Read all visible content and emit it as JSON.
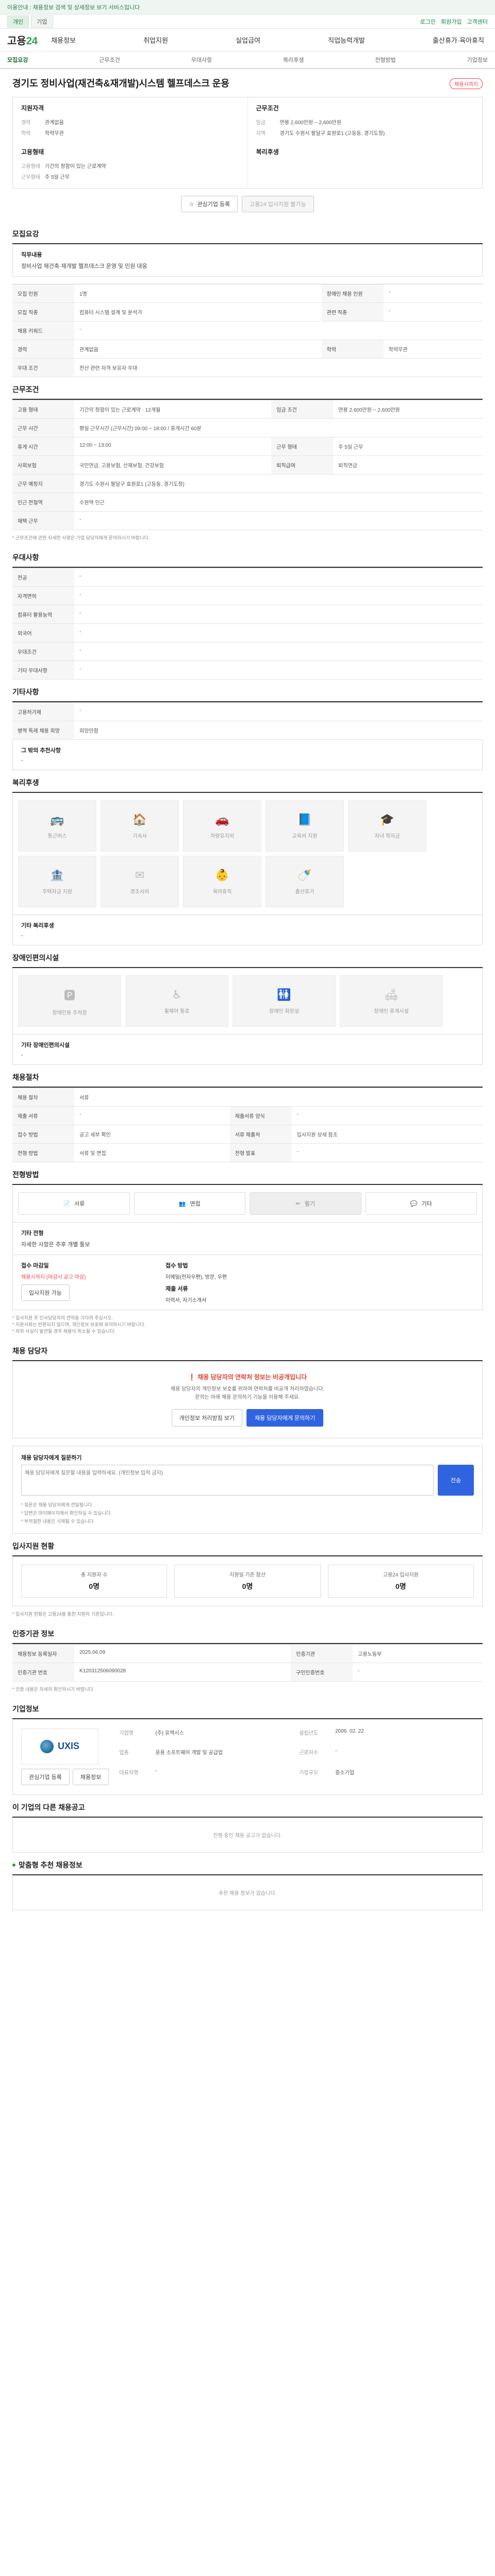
{
  "topbar": {
    "notice": "이용안내 : 채용정보 검색 및 상세정보 보기 서비스입니다"
  },
  "header": {
    "tabs": [
      "개인",
      "기업"
    ],
    "links": [
      "로그인",
      "회원가입",
      "고객센터"
    ]
  },
  "logo": {
    "main": "고용",
    "accent": "24"
  },
  "gnb": [
    "채용정보",
    "취업지원",
    "실업급여",
    "직업능력개발",
    "출산휴가·육아휴직"
  ],
  "subnav": [
    "모집요강",
    "근무조건",
    "우대사항",
    "복리후생",
    "전형방법",
    "기업정보"
  ],
  "job": {
    "title": "경기도 정비사업(재건축&재개발)시스템 헬프데스크 운용",
    "badge": "채용시까지"
  },
  "summary": {
    "left": {
      "title": "지원자격",
      "rows": [
        {
          "k": "경력",
          "v": "관계없음"
        },
        {
          "k": "학력",
          "v": "학력무관"
        }
      ]
    },
    "right": {
      "title": "근무조건",
      "rows": [
        {
          "k": "임금",
          "v": "연봉 2,600만원 ~ 2,600만원"
        },
        {
          "k": "지역",
          "v": "경기도 수원시 팔달구 효원로1 (고등동, 경기도청)"
        }
      ]
    },
    "left2": {
      "title": "고용형태",
      "rows": [
        {
          "k": "고용형태",
          "v": "기간의 정함이 있는 근로계약"
        },
        {
          "k": "근무형태",
          "v": "주 5일 근무"
        }
      ]
    },
    "right2": {
      "title": "복리후생",
      "rows": []
    }
  },
  "actions": {
    "interest": "관심기업 등록",
    "apply": "고용24 입사지원 불가능"
  },
  "recruit": {
    "title": "모집요강",
    "duty_title": "직무내용",
    "duty": "정비사업 재건축·재개발 헬프데스크 운영 및 민원 대응",
    "rows": [
      {
        "k": "모집 인원",
        "v": "1명",
        "k2": "장애인 채용 인원",
        "v2": "-"
      },
      {
        "k": "모집 직종",
        "v": "컴퓨터 시스템 설계 및 분석가",
        "k2": "관련 직종",
        "v2": "-"
      },
      {
        "k": "채용 키워드",
        "v": "-",
        "k2": "",
        "v2": ""
      },
      {
        "k": "경력",
        "v": "관계없음",
        "k2": "학력",
        "v2": "학력무관"
      },
      {
        "k": "우대 조건",
        "v": "전산 관련 자격 보유자 우대",
        "k2": "",
        "v2": ""
      }
    ]
  },
  "conditions": {
    "title": "근무조건",
    "rows": [
      {
        "k": "고용 형태",
        "v": "기간의 정함이 있는 근로계약 · 12개월",
        "k2": "임금 조건",
        "v2": "연봉 2,600만원 ~ 2,600만원"
      },
      {
        "k": "근무 시간",
        "v": "평일 근무시간 (근무시간) 09:00 ~ 18:00 / 휴게시간 60분",
        "k2": "",
        "": ""
      },
      {
        "k": "휴게 시간",
        "v": "12:00 ~ 13:00",
        "k2": "근무 형태",
        "v2": "주 5일 근무"
      },
      {
        "k": "사회보험",
        "v": "국민연금, 고용보험, 산재보험, 건강보험",
        "k2": "퇴직급여",
        "v2": "퇴직연금"
      },
      {
        "k": "근무 예정지",
        "v": "경기도 수원시 팔달구 효원로1 (고등동, 경기도청)",
        "k2": "",
        "": ""
      },
      {
        "k": "인근 전철역",
        "v": "수원역 인근",
        "k2": "",
        "": ""
      },
      {
        "k": "재택 근무",
        "v": "-",
        "k2": "",
        "": ""
      }
    ],
    "note": "* 근무조건에 관한 자세한 사항은 기업 담당자에게 문의하시기 바랍니다."
  },
  "preference": {
    "title": "우대사항",
    "rows": [
      {
        "k": "전공",
        "v": "-"
      },
      {
        "k": "자격면허",
        "v": "-"
      },
      {
        "k": "컴퓨터 활용능력",
        "v": "-"
      },
      {
        "k": "외국어",
        "v": "-"
      },
      {
        "k": "우대조건",
        "v": "-"
      },
      {
        "k": "기타 우대사항",
        "v": "-"
      }
    ]
  },
  "etc": {
    "title": "기타사항",
    "rows": [
      {
        "k": "고용허가제",
        "v": "-"
      },
      {
        "k": "병역 특례 채용 희망",
        "v": "희망안함"
      }
    ],
    "extra_title": "그 밖의 추천사항",
    "extra": "-"
  },
  "welfare": {
    "title": "복리후생",
    "items": [
      "통근버스",
      "기숙사",
      "차량유지비",
      "교육비 지원",
      "자녀 학자금",
      "주택자금 지원",
      "경조사비",
      "육아휴직",
      "출산휴가"
    ],
    "etc_title": "기타 복리후생",
    "etc": "-"
  },
  "disability": {
    "title": "장애인편의시설",
    "items": [
      "장애인용 주차장",
      "휠체어 통로",
      "장애인 화장실",
      "장애인 휴게시설"
    ],
    "etc_title": "기타 장애인편의시설",
    "etc": "-"
  },
  "process": {
    "title": "채용절차",
    "rows": [
      {
        "k": "채용 절차",
        "v": "서류",
        "k2": "",
        "": ""
      },
      {
        "k": "제출 서류",
        "v": "-",
        "k2": "제출서류 양식",
        "v2": "-"
      },
      {
        "k": "접수 방법",
        "v": "공고 세부 확인",
        "k2": "서류 제출처",
        "v2": "입사지원 상세 참조"
      },
      {
        "k": "전형 방법",
        "v": "서류 및 면접",
        "k2": "전형 발표",
        "v2": "-"
      }
    ]
  },
  "steps": {
    "title": "전형방법",
    "items": [
      "서류",
      "면접",
      "필기",
      "기타"
    ],
    "active": 2,
    "etc_title": "기타 전형",
    "etc": "자세한 사항은 추후 개별 통보"
  },
  "apply": {
    "left_title": "접수 마감일",
    "left_val": "채용시까지 (마감시 공고 마감)",
    "left_btn": "입사지원 가능",
    "right_title": "접수 방법",
    "right_val": "이메일(전자우편), 방문, 우편",
    "right_title2": "제출 서류",
    "right_val2": "이력서, 자기소개서",
    "notes": [
      "* 입사지원 후 인사담당자의 연락을 기다려 주십시오.",
      "* 지원서류는 반환되지 않으며, 개인정보 보호에 유의하시기 바랍니다.",
      "* 허위 사실이 발견될 경우 채용이 취소될 수 있습니다."
    ]
  },
  "contact": {
    "title": "채용 담당자",
    "alert": "채용 담당자의 연락처 정보는 비공개입니다",
    "msg1": "채용 담당자의 개인정보 보호를 위하여 연락처를 비공개 처리하였습니다.",
    "msg2": "문의는 아래 채용 문의하기 기능을 이용해 주세요.",
    "btn1": "개인정보 처리방침 보기",
    "btn2": "채용 담당자에게 문의하기"
  },
  "ask": {
    "title": "채용 담당자에게 질문하기",
    "placeholder": "채용 담당자에게 질문할 내용을 입력하세요. (개인정보 입력 금지)",
    "send": "전송",
    "notes": [
      "* 질문은 채용 담당자에게 전달됩니다.",
      "* 답변은 마이페이지에서 확인하실 수 있습니다.",
      "* 부적절한 내용은 삭제될 수 있습니다."
    ]
  },
  "stats": {
    "title": "입사지원 현황",
    "items": [
      {
        "k": "총 지원자 수",
        "v": "0명"
      },
      {
        "k": "지원일 기준 합산",
        "v": "0명"
      },
      {
        "k": "고용24 입사지원",
        "v": "0명"
      }
    ],
    "note": "* 입사지원 현황은 고용24를 통한 지원자 기준입니다."
  },
  "info": {
    "title": "인증기관 정보",
    "rows": [
      {
        "k": "채용정보 등록일자",
        "v": "2025.06.09",
        "k2": "인증기관",
        "v2": "고용노동부"
      },
      {
        "k": "인증기관 번호",
        "v": "K120312506090028",
        "k2": "구인인증번호",
        "v2": "-"
      }
    ],
    "note": "* 인증 내용은 자세히 확인하시기 바랍니다."
  },
  "company": {
    "title": "기업정보",
    "name": "UXIS",
    "fields": [
      {
        "k": "기업명",
        "v": "(주) 유엑시스"
      },
      {
        "k": "설립년도",
        "v": "2006. 02. 22"
      },
      {
        "k": "업종",
        "v": "응용 소프트웨어 개발 및 공급업"
      },
      {
        "k": "근로자수",
        "v": "-"
      },
      {
        "k": "대표자명",
        "v": "-"
      },
      {
        "k": "기업규모",
        "v": "중소기업"
      }
    ],
    "btn_a": "관심기업 등록",
    "btn_b": "채용정보"
  },
  "others": {
    "title": "이 기업의 다른 채용공고",
    "empty": "진행 중인 채용 공고가 없습니다."
  },
  "recommend": {
    "title": "맞춤형 추천 채용정보",
    "empty": "추천 채용 정보가 없습니다."
  }
}
